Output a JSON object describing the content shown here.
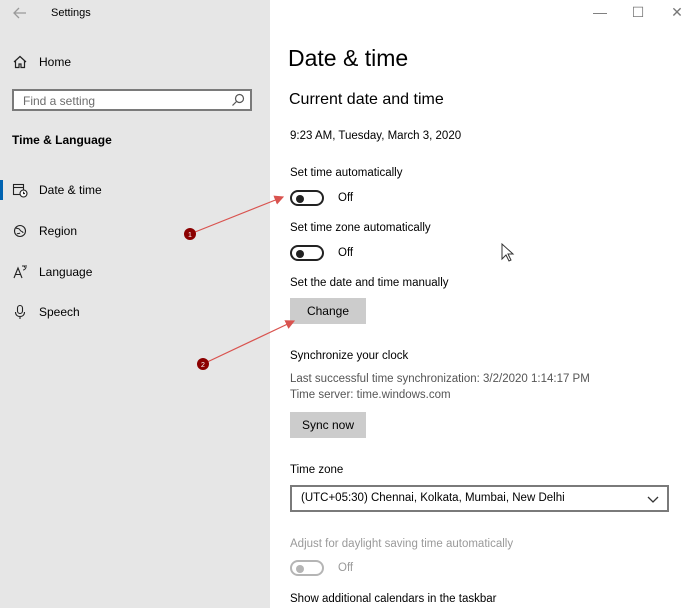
{
  "window": {
    "title": "Settings",
    "back_icon": "back-arrow-icon",
    "minimize_glyph": "—",
    "maximize_glyph": "☐",
    "close_glyph": "✕"
  },
  "sidebar": {
    "home_label": "Home",
    "search_placeholder": "Find a setting",
    "section_heading": "Time & Language",
    "items": [
      {
        "label": "Date & time",
        "icon": "calendar-clock-icon",
        "selected": true
      },
      {
        "label": "Region",
        "icon": "globe-icon",
        "selected": false
      },
      {
        "label": "Language",
        "icon": "language-icon",
        "selected": false
      },
      {
        "label": "Speech",
        "icon": "microphone-icon",
        "selected": false
      }
    ]
  },
  "main": {
    "page_title": "Date & time",
    "section_title": "Current date and time",
    "current_datetime": "9:23 AM, Tuesday, March 3, 2020",
    "set_time_auto": {
      "label": "Set time automatically",
      "state": "Off"
    },
    "set_timezone_auto": {
      "label": "Set time zone automatically",
      "state": "Off"
    },
    "manual": {
      "label": "Set the date and time manually",
      "button": "Change"
    },
    "sync": {
      "heading": "Synchronize your clock",
      "last_sync": "Last successful time synchronization: 3/2/2020 1:14:17 PM",
      "server": "Time server: time.windows.com",
      "button": "Sync now"
    },
    "timezone": {
      "label": "Time zone",
      "value": "(UTC+05:30) Chennai, Kolkata, Mumbai, New Delhi"
    },
    "daylight": {
      "label": "Adjust for daylight saving time automatically",
      "state": "Off"
    },
    "calendars_label": "Show additional calendars in the taskbar"
  },
  "annotations": [
    {
      "number": "1"
    },
    {
      "number": "2"
    }
  ],
  "colors": {
    "sidebar_bg": "#e6e6e6",
    "accent": "#0063b1",
    "annotation": "#8b0000",
    "button_bg": "#cccccc"
  }
}
